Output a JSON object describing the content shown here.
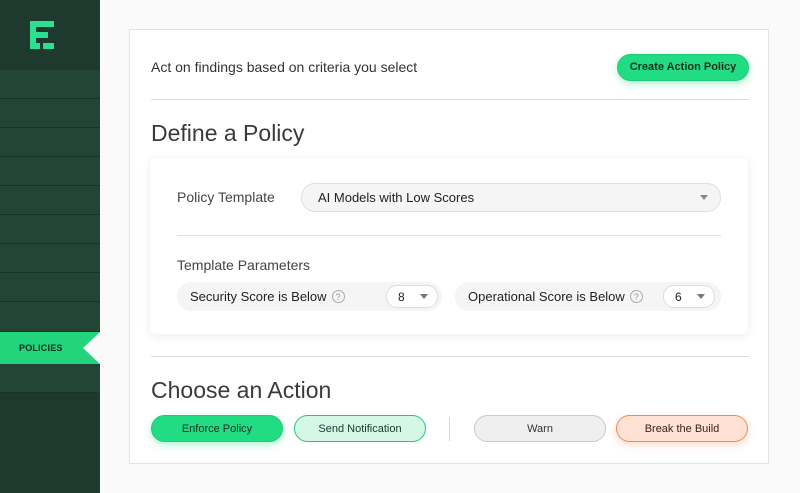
{
  "sidebar": {
    "active_item_label": "POLICIES",
    "colors": {
      "background": "#1e3a2f",
      "accent": "#22d47b"
    }
  },
  "header": {
    "description": "Act on findings based on criteria you select",
    "create_button_label": "Create Action Policy"
  },
  "define": {
    "title": "Define a Policy",
    "template_label": "Policy Template",
    "template_value": "AI Models with Low Scores",
    "parameters_label": "Template Parameters",
    "parameters": [
      {
        "label": "Security Score is Below",
        "value": "8",
        "help_icon": "?"
      },
      {
        "label": "Operational Score is Below",
        "value": "6",
        "help_icon": "?"
      }
    ]
  },
  "actions": {
    "title": "Choose an Action",
    "enforce_label": "Enforce Policy",
    "notify_label": "Send Notification",
    "warn_label": "Warn",
    "break_label": "Break the Build"
  },
  "colors": {
    "primary": "#22dc83",
    "notify_bg": "#d4f7e6",
    "warn_bg": "#efefef",
    "break_bg": "#ffe2d3",
    "break_border": "#f08a55"
  }
}
